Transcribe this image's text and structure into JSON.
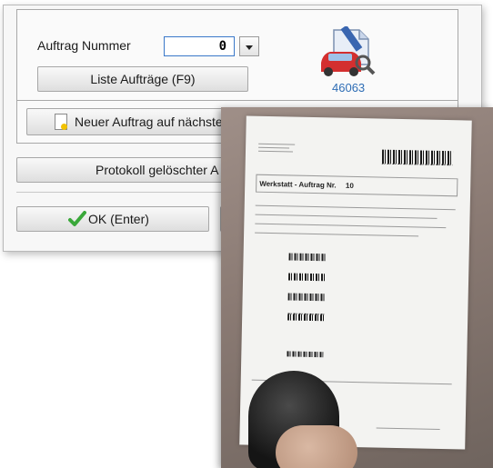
{
  "dialog": {
    "order_number_label": "Auftrag Nummer",
    "order_number_value": "0",
    "list_orders_button": "Liste Aufträge (F9)",
    "new_order_button": "Neuer Auftrag auf nächste",
    "deleted_log_button": "Protokoll gelöschter A",
    "ok_button": "OK (Enter)",
    "order_id_badge": "46063"
  },
  "photo": {
    "doc_title": "Werkstatt - Auftrag Nr.",
    "doc_order_no": "10"
  },
  "colors": {
    "input_border": "#3a78c9",
    "badge_text": "#2e6db5",
    "car_red": "#d32f2f",
    "check_green": "#3aa83a"
  }
}
